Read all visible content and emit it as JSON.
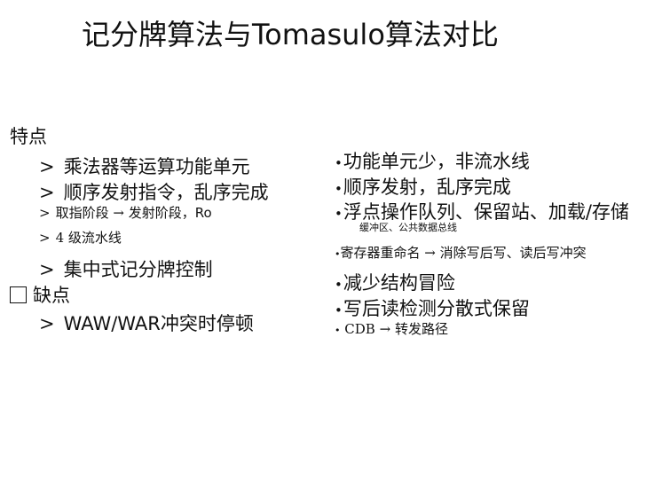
{
  "title": "记分牌算法与Tomasulo算法对比",
  "left": {
    "features_heading": "特点",
    "feature_1": "乘法器等运算功能单元",
    "feature_2": "顺序发射指令，乱序完成",
    "feature_3_a": "取指阶段",
    "feature_3_arrow": "→",
    "feature_3_b": "发射阶段，Ro",
    "feature_4_num": "4",
    "feature_4_text": "级流水线",
    "feature_5": "集中式记分牌控制",
    "cons_heading": "缺点",
    "con_1": "WAW/WAR冲突时停顿",
    "bullet": ">"
  },
  "right": {
    "item_1": "功能单元少，非流水线",
    "item_2": "顺序发射，乱序完成",
    "item_3": "浮点操作队列、保留站、加载/存储",
    "item_3_note": "缓冲区、公共数据总线",
    "item_4_a": "寄存器重命名",
    "item_4_arrow": "→",
    "item_4_b": "消除写后写、读后写冲突",
    "item_5": "减少结构冒险",
    "item_6": "写后读检测分散式保留",
    "item_7_a": "CDB",
    "item_7_arrow": "→",
    "item_7_b": "转发路径",
    "bullet": "•"
  }
}
